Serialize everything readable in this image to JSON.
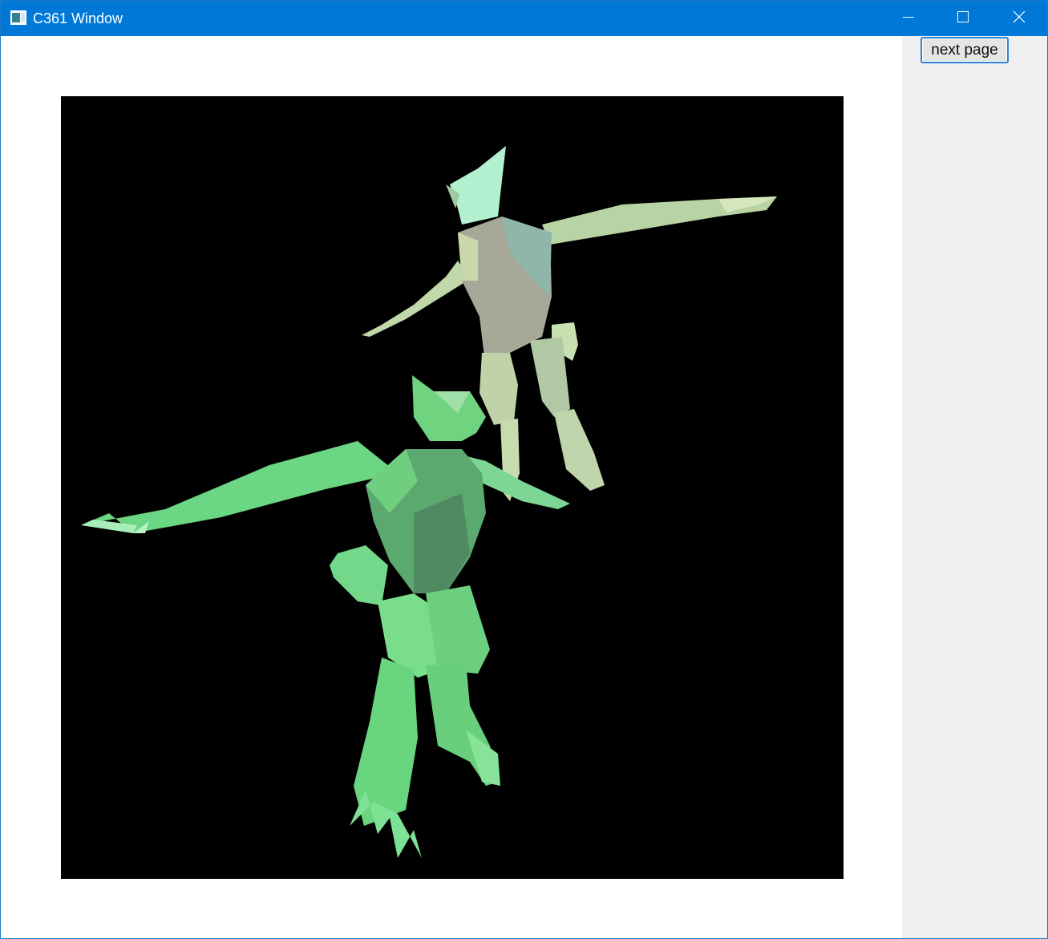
{
  "window": {
    "title": "C361 Window",
    "icons": {
      "app": "window-app-icon",
      "minimize": "minimize-icon",
      "maximize": "maximize-icon",
      "close": "close-icon"
    },
    "colors": {
      "titlebar": "#0078d7",
      "side_panel": "#f0f0f0",
      "viewport_background": "#000000",
      "model_front": "#5fd27a",
      "model_back": "#b9d9a7"
    }
  },
  "side_panel": {
    "next_button_label": "next page"
  }
}
